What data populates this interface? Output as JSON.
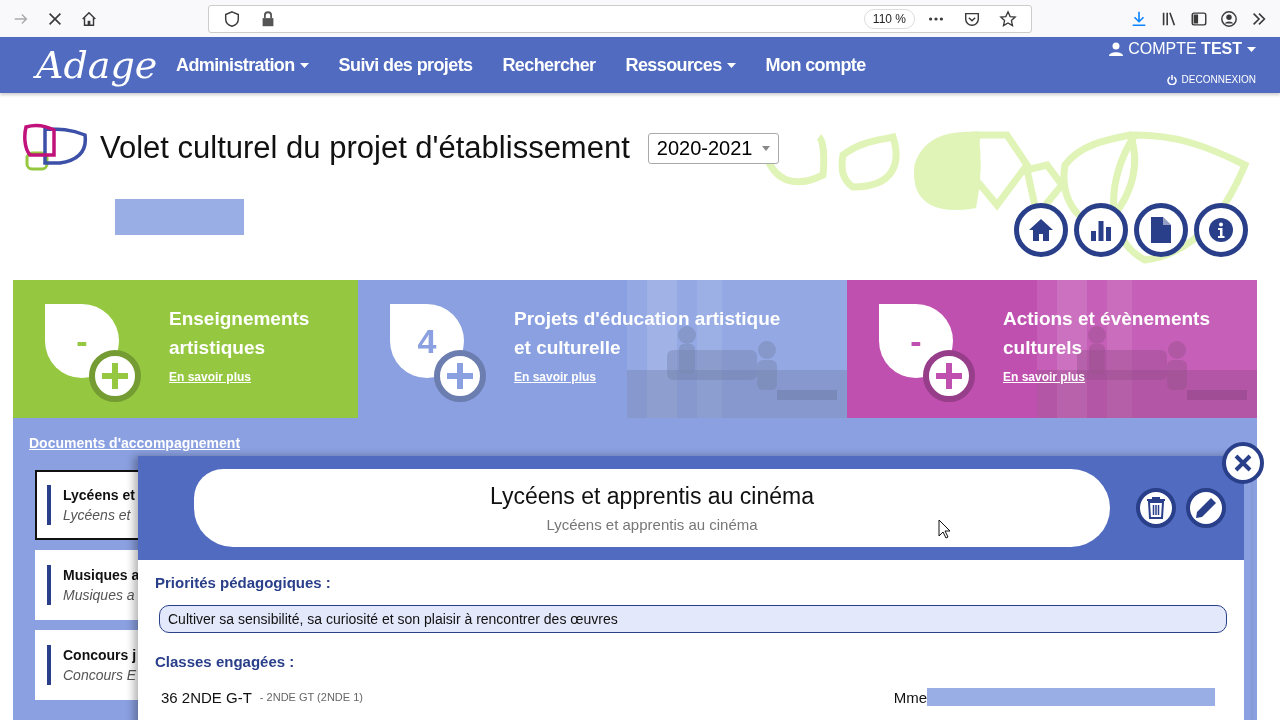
{
  "browser": {
    "zoom": "110 %"
  },
  "nav": {
    "logo": "Adage",
    "items": [
      {
        "label": "Administration",
        "dropdown": true
      },
      {
        "label": "Suivi des projets",
        "dropdown": false
      },
      {
        "label": "Rechercher",
        "dropdown": false
      },
      {
        "label": "Ressources",
        "dropdown": true
      },
      {
        "label": "Mon compte",
        "dropdown": false
      }
    ],
    "account": "COMPTE **TEST**",
    "logout": "DECONNEXION"
  },
  "header": {
    "title": "Volet culturel du projet d'établissement",
    "year": "2020-2021"
  },
  "tiles": [
    {
      "title_lines": [
        "Enseignements",
        "artistiques"
      ],
      "count": "-",
      "link": "En savoir plus",
      "color": "#95c840",
      "photo": false
    },
    {
      "title_lines": [
        "Projets d'éducation artistique",
        "et culturelle"
      ],
      "count": "4",
      "link": "En savoir plus",
      "color": "#8aa0e0",
      "photo": true
    },
    {
      "title_lines": [
        "Actions et évènements",
        "culturels"
      ],
      "count": "-",
      "link": "En savoir plus",
      "color": "#c050b0",
      "photo": true
    }
  ],
  "documents": {
    "link": "Documents d'accompagnement",
    "items": [
      {
        "title": "Lycéens et",
        "subtitle": "Lycéens et",
        "selected": true
      },
      {
        "title": "Musiques a",
        "subtitle": "Musiques a",
        "selected": false
      },
      {
        "title": "Concours j",
        "subtitle": "Concours E",
        "selected": false
      }
    ]
  },
  "modal": {
    "title": "Lycéens et apprentis au cinéma",
    "subtitle": "Lycéens et apprentis au cinéma",
    "priorities_label": "Priorités pédagogiques :",
    "priorities": [
      "Cultiver sa sensibilité, sa curiosité et son plaisir à rencontrer des œuvres"
    ],
    "classes_label": "Classes engagées :",
    "classes": [
      {
        "name": "36 2NDE G-T",
        "detail": "- 2NDE GT (2NDE 1)",
        "teacher": "Mme"
      }
    ]
  }
}
